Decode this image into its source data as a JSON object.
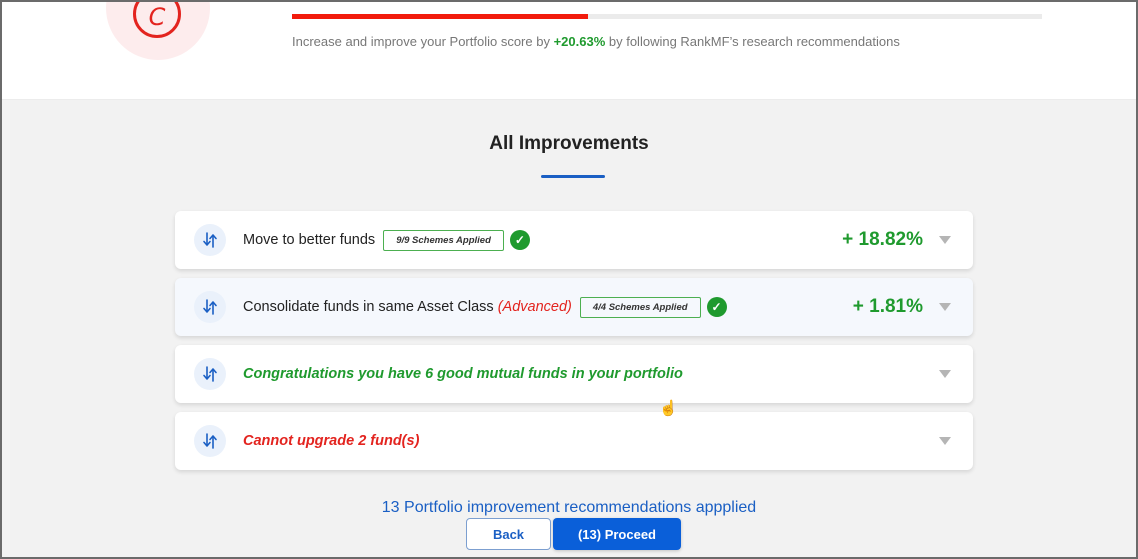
{
  "header": {
    "grade": "C",
    "score_progress_percent": 39.5,
    "improve_prefix": "Increase and improve your Portfolio score by ",
    "improve_pct": "+20.63%",
    "improve_suffix": " by following RankMF’s research recommendations"
  },
  "section": {
    "title": "All Improvements"
  },
  "improvements": [
    {
      "label": "Move to better funds",
      "badge": "9/9 Schemes Applied",
      "applied": true,
      "pct": "+ 18.82%",
      "icon": "swap-vertical-icon"
    },
    {
      "label": "Consolidate funds in same Asset Class ",
      "label_tag": "(Advanced)",
      "badge": "4/4 Schemes Applied",
      "applied": true,
      "pct": "+ 1.81%",
      "icon": "swap-vertical-icon"
    },
    {
      "label": "Congratulations you have 6 good mutual funds in your portfolio",
      "icon": "swap-vertical-icon"
    },
    {
      "label": "Cannot upgrade 2 fund(s)",
      "icon": "swap-vertical-icon"
    }
  ],
  "footer": {
    "summary": "13 Portfolio improvement recommendations appplied",
    "back_label": "Back",
    "proceed_label": "(13) Proceed"
  },
  "icons": {
    "check": "✓",
    "cursor": "☝"
  },
  "colors": {
    "positive": "#1f9a2e",
    "negative": "#e3241f",
    "accent": "#1a5fc4",
    "primary_button": "#0a5fd9"
  }
}
